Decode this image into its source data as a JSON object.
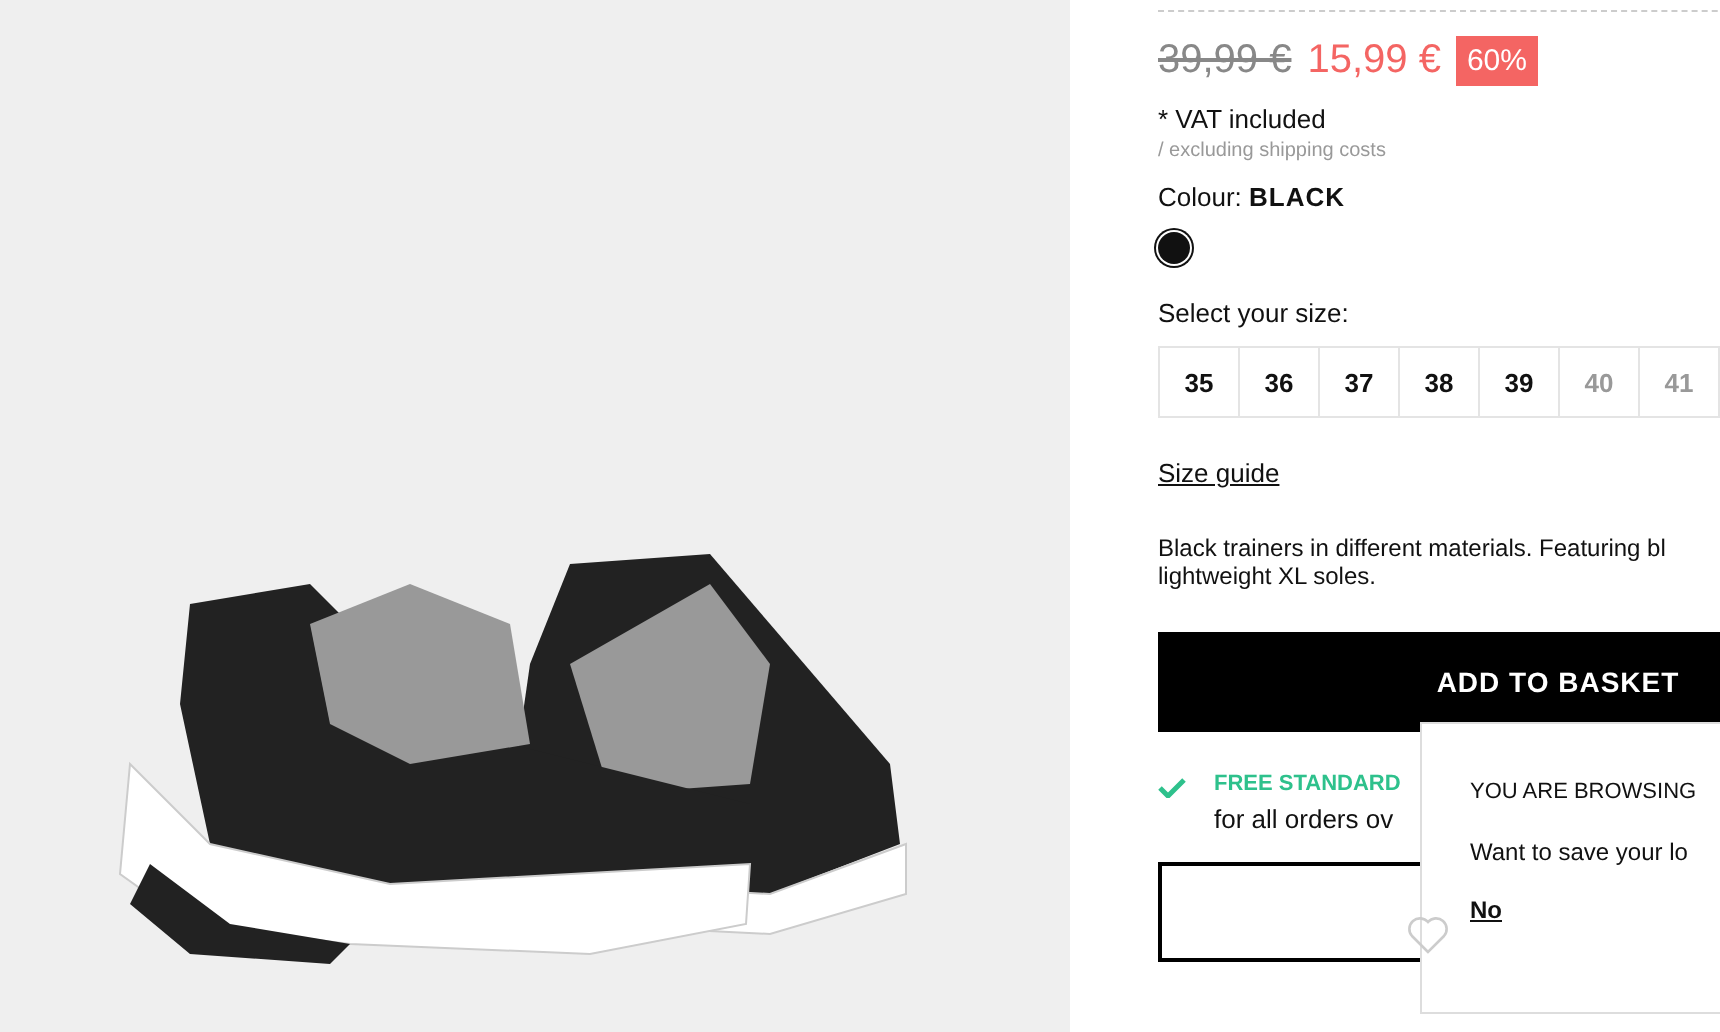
{
  "price": {
    "old": "39,99 €",
    "new": "15,99 €",
    "discount": "60%"
  },
  "vat": "* VAT included",
  "shipping_note": "/ excluding shipping costs",
  "colour": {
    "label": "Colour:",
    "value": "BLACK",
    "swatches": [
      {
        "color": "#111111",
        "selected": true
      }
    ]
  },
  "size_label": "Select your size:",
  "sizes": [
    {
      "label": "35",
      "disabled": false
    },
    {
      "label": "36",
      "disabled": false
    },
    {
      "label": "37",
      "disabled": false
    },
    {
      "label": "38",
      "disabled": false
    },
    {
      "label": "39",
      "disabled": false
    },
    {
      "label": "40",
      "disabled": true
    },
    {
      "label": "41",
      "disabled": true
    }
  ],
  "size_guide": "Size guide",
  "description": "Black trainers in different materials. Featuring bl\nlightweight XL soles.",
  "add_button": "ADD TO BASKET",
  "delivery": {
    "title": "FREE STANDARD",
    "note": "for all orders ov"
  },
  "popup": {
    "title": "YOU ARE BROWSING",
    "text": "Want to save your lo",
    "no_link": "No"
  }
}
